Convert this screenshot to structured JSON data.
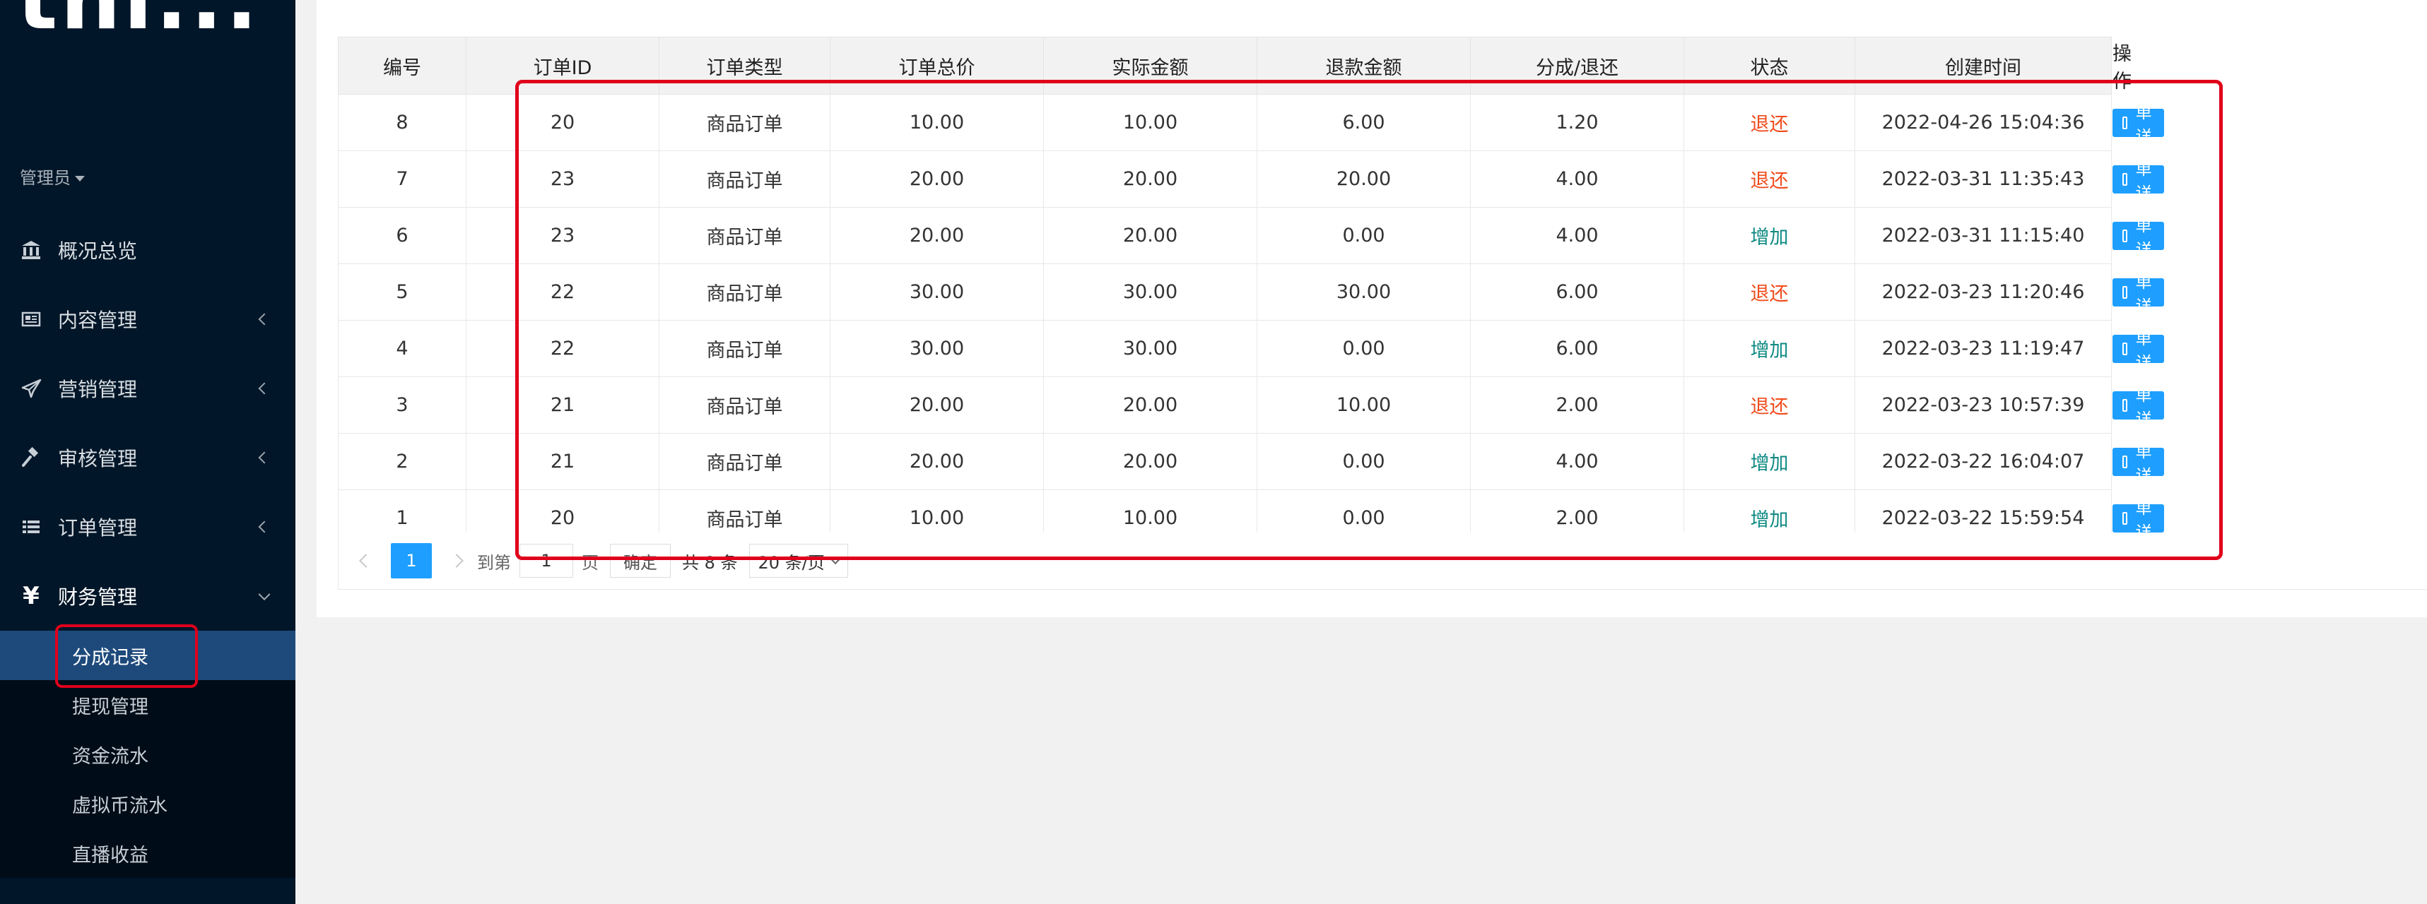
{
  "app": {
    "logo_text": "thi..."
  },
  "sidebar": {
    "role_label": "管理员",
    "menu": [
      {
        "label": "概况总览",
        "icon": "bank-icon",
        "has_chevron": false
      },
      {
        "label": "内容管理",
        "icon": "newspaper-icon",
        "has_chevron": true
      },
      {
        "label": "营销管理",
        "icon": "paper-plane-icon",
        "has_chevron": true
      },
      {
        "label": "审核管理",
        "icon": "gavel-icon",
        "has_chevron": true
      },
      {
        "label": "订单管理",
        "icon": "list-icon",
        "has_chevron": true
      },
      {
        "label": "财务管理",
        "icon": "yen-icon",
        "has_chevron": true,
        "open": true
      }
    ],
    "submenu": [
      {
        "label": "分成记录",
        "active": true
      },
      {
        "label": "提现管理"
      },
      {
        "label": "资金流水"
      },
      {
        "label": "虚拟币流水"
      },
      {
        "label": "直播收益"
      }
    ]
  },
  "table": {
    "headers": [
      "编号",
      "订单ID",
      "订单类型",
      "订单总价",
      "实际金额",
      "退款金额",
      "分成/退还",
      "状态",
      "创建时间",
      "",
      "操作"
    ],
    "rows": [
      {
        "no": "8",
        "order_id": "20",
        "type": "商品订单",
        "total": "10.00",
        "actual": "10.00",
        "refund": "6.00",
        "share": "1.20",
        "status": "退还",
        "status_color": "#f04b1b",
        "created": "2022-04-26 15:04:36",
        "action": "订单详情"
      },
      {
        "no": "7",
        "order_id": "23",
        "type": "商品订单",
        "total": "20.00",
        "actual": "20.00",
        "refund": "20.00",
        "share": "4.00",
        "status": "退还",
        "status_color": "#f04b1b",
        "created": "2022-03-31 11:35:43",
        "action": "订单详情"
      },
      {
        "no": "6",
        "order_id": "23",
        "type": "商品订单",
        "total": "20.00",
        "actual": "20.00",
        "refund": "0.00",
        "share": "4.00",
        "status": "增加",
        "status_color": "#0f8a83",
        "created": "2022-03-31 11:15:40",
        "action": "订单详情"
      },
      {
        "no": "5",
        "order_id": "22",
        "type": "商品订单",
        "total": "30.00",
        "actual": "30.00",
        "refund": "30.00",
        "share": "6.00",
        "status": "退还",
        "status_color": "#f04b1b",
        "created": "2022-03-23 11:20:46",
        "action": "订单详情"
      },
      {
        "no": "4",
        "order_id": "22",
        "type": "商品订单",
        "total": "30.00",
        "actual": "30.00",
        "refund": "0.00",
        "share": "6.00",
        "status": "增加",
        "status_color": "#0f8a83",
        "created": "2022-03-23 11:19:47",
        "action": "订单详情"
      },
      {
        "no": "3",
        "order_id": "21",
        "type": "商品订单",
        "total": "20.00",
        "actual": "20.00",
        "refund": "10.00",
        "share": "2.00",
        "status": "退还",
        "status_color": "#f04b1b",
        "created": "2022-03-23 10:57:39",
        "action": "订单详情"
      },
      {
        "no": "2",
        "order_id": "21",
        "type": "商品订单",
        "total": "20.00",
        "actual": "20.00",
        "refund": "0.00",
        "share": "4.00",
        "status": "增加",
        "status_color": "#0f8a83",
        "created": "2022-03-22 16:04:07",
        "action": "订单详情"
      },
      {
        "no": "1",
        "order_id": "20",
        "type": "商品订单",
        "total": "10.00",
        "actual": "10.00",
        "refund": "0.00",
        "share": "2.00",
        "status": "增加",
        "status_color": "#0f8a83",
        "created": "2022-03-22 15:59:54",
        "action": "订单详情"
      }
    ]
  },
  "pager": {
    "current_page": "1",
    "goto_label": "到第",
    "goto_value": "1",
    "page_unit": "页",
    "confirm_label": "确定",
    "total_label": "共 8 条",
    "page_size": "20 条/页"
  },
  "colors": {
    "accent": "#1e9fff",
    "sidebar_bg": "#011628",
    "highlight": "#e0001b",
    "status_refund": "#f04b1b",
    "status_add": "#0f8a83"
  }
}
